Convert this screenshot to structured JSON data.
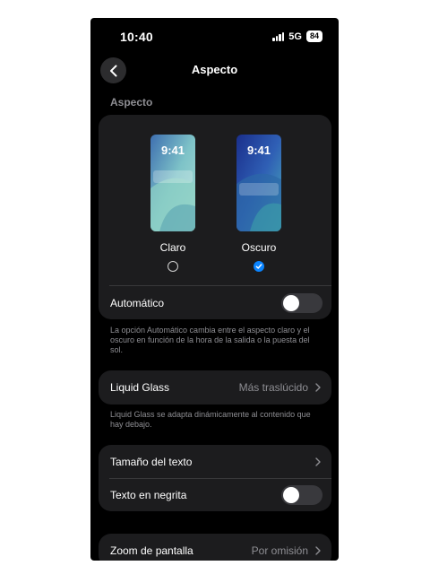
{
  "status_bar": {
    "time": "10:40",
    "network": "5G",
    "battery": "84"
  },
  "nav": {
    "title": "Aspecto",
    "back_icon": "chevron-left-icon"
  },
  "section": {
    "title": "Aspecto"
  },
  "appearance": {
    "options": [
      {
        "label": "Claro",
        "preview_time": "9:41",
        "selected": false
      },
      {
        "label": "Oscuro",
        "preview_time": "9:41",
        "selected": true
      }
    ],
    "automatic": {
      "label": "Automático",
      "enabled": false
    },
    "footnote": "La opción Automático cambia entre el aspecto claro y el oscuro en función de la hora de la salida o la puesta del sol."
  },
  "liquid_glass": {
    "label": "Liquid Glass",
    "value": "Más traslúcido",
    "footnote": "Liquid Glass se adapta dinámicamente al contenido que hay debajo."
  },
  "text_settings": {
    "text_size_label": "Tamaño del texto",
    "bold_label": "Texto en negrita",
    "bold_enabled": false
  },
  "display_zoom": {
    "label": "Zoom de pantalla",
    "value": "Por omisión"
  },
  "colors": {
    "accent": "#0a84ff",
    "card": "#1c1c1e",
    "secondary_text": "#8e8e93"
  }
}
